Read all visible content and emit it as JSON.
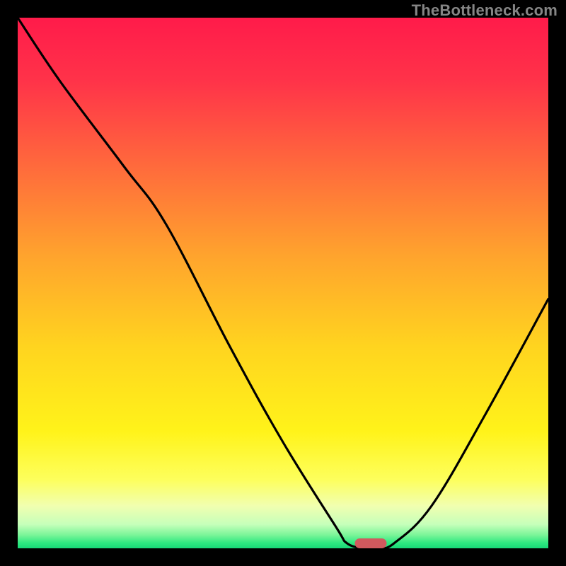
{
  "watermark": "TheBottleneck.com",
  "marker": {
    "x_frac": 0.665,
    "y_frac": 0.991
  },
  "gradient_stops": [
    {
      "offset": 0.0,
      "color": "#ff1b4a"
    },
    {
      "offset": 0.12,
      "color": "#ff3349"
    },
    {
      "offset": 0.28,
      "color": "#ff6a3c"
    },
    {
      "offset": 0.45,
      "color": "#ffa42d"
    },
    {
      "offset": 0.62,
      "color": "#ffd41f"
    },
    {
      "offset": 0.78,
      "color": "#fff31a"
    },
    {
      "offset": 0.87,
      "color": "#fdff5c"
    },
    {
      "offset": 0.92,
      "color": "#f1ffb0"
    },
    {
      "offset": 0.955,
      "color": "#c6ffba"
    },
    {
      "offset": 0.975,
      "color": "#7af598"
    },
    {
      "offset": 0.99,
      "color": "#2de880"
    },
    {
      "offset": 1.0,
      "color": "#18d877"
    }
  ],
  "chart_data": {
    "type": "line",
    "title": "",
    "xlabel": "",
    "ylabel": "",
    "xlim": [
      0,
      100
    ],
    "ylim": [
      0,
      100
    ],
    "series": [
      {
        "name": "bottleneck-curve",
        "x": [
          0,
          8,
          20,
          28,
          40,
          50,
          60,
          62,
          65,
          68,
          71,
          78,
          88,
          100
        ],
        "values": [
          100,
          88,
          72,
          61,
          38,
          20,
          4,
          1,
          0,
          0,
          1,
          8,
          25,
          47
        ]
      }
    ],
    "annotations": [
      {
        "type": "marker",
        "name": "optimal-point",
        "x": 66.5,
        "y": 0.9
      }
    ]
  }
}
